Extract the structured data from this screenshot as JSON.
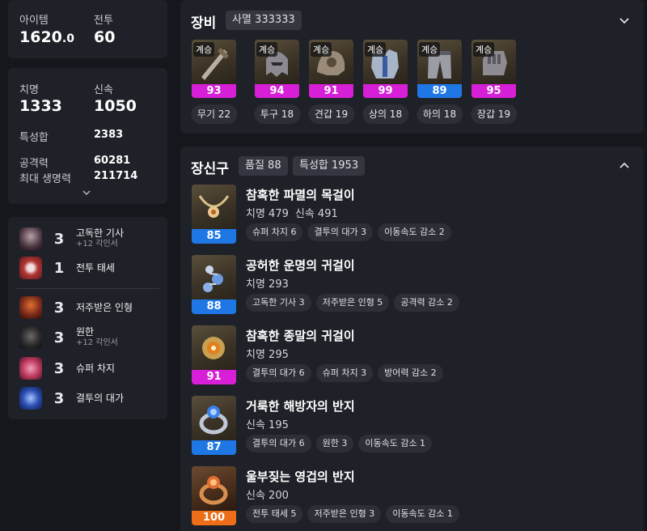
{
  "summary": {
    "item_level_label": "아이템",
    "item_level_main": "1620",
    "item_level_decimal": ".0",
    "combat_label": "전투",
    "combat_value": "60"
  },
  "stats": {
    "crit_label": "치명",
    "crit_value": "1333",
    "swift_label": "신속",
    "swift_value": "1050",
    "total_label": "특성합",
    "total_value": "2383",
    "attack_label": "공격력",
    "attack_value": "60281",
    "hp_label": "최대 생명력",
    "hp_value": "211714"
  },
  "engravings": {
    "class": [
      {
        "level": "3",
        "name": "고독한 기사",
        "sub": "+12 각인서",
        "color": "#4a3540"
      },
      {
        "level": "1",
        "name": "전투 태세",
        "sub": "",
        "color": "#b33535"
      }
    ],
    "items": [
      {
        "level": "3",
        "name": "저주받은 인형",
        "sub": "",
        "color": "#7a2a1a"
      },
      {
        "level": "3",
        "name": "원한",
        "sub": "+12 각인서",
        "color": "#2a2a2a"
      },
      {
        "level": "3",
        "name": "슈퍼 차지",
        "sub": "",
        "color": "#c23e62"
      },
      {
        "level": "3",
        "name": "결투의 대가",
        "sub": "",
        "color": "#2c4fb3"
      }
    ]
  },
  "equipment": {
    "title": "장비",
    "tag": "사멸 333333",
    "items": [
      {
        "badge": "계승",
        "quality": "93",
        "label": "무기 22",
        "quality_color": "#d61fd6"
      },
      {
        "badge": "계승",
        "quality": "94",
        "label": "투구 18",
        "quality_color": "#d61fd6"
      },
      {
        "badge": "계승",
        "quality": "91",
        "label": "견갑 19",
        "quality_color": "#d61fd6"
      },
      {
        "badge": "계승",
        "quality": "99",
        "label": "상의 18",
        "quality_color": "#d61fd6"
      },
      {
        "badge": "계승",
        "quality": "89",
        "label": "하의 18",
        "quality_color": "#1f77e6"
      },
      {
        "badge": "계승",
        "quality": "95",
        "label": "장갑 19",
        "quality_color": "#d61fd6"
      }
    ]
  },
  "accessories": {
    "title": "장신구",
    "quality_tag": "품질 88",
    "stat_tag": "특성합 1953",
    "items": [
      {
        "quality": "85",
        "name": "참혹한 파멸의 목걸이",
        "stats": [
          "치명 479",
          "신속 491"
        ],
        "engravings": [
          "슈퍼 차지 6",
          "결투의 대가 3",
          "이동속도 감소 2"
        ],
        "quality_color": "#1f77e6"
      },
      {
        "quality": "88",
        "name": "공허한 운명의 귀걸이",
        "stats": [
          "치명 293"
        ],
        "engravings": [
          "고독한 기사 3",
          "저주받은 인형 5",
          "공격력 감소 2"
        ],
        "quality_color": "#1f77e6"
      },
      {
        "quality": "91",
        "name": "참혹한 종말의 귀걸이",
        "stats": [
          "치명 295"
        ],
        "engravings": [
          "결투의 대가 6",
          "슈퍼 차지 3",
          "방어력 감소 2"
        ],
        "quality_color": "#d61fd6"
      },
      {
        "quality": "87",
        "name": "거룩한 해방자의 반지",
        "stats": [
          "신속 195"
        ],
        "engravings": [
          "결투의 대가 6",
          "원한 3",
          "이동속도 감소 1"
        ],
        "quality_color": "#1f77e6"
      },
      {
        "quality": "100",
        "name": "울부짖는 영겁의 반지",
        "stats": [
          "신속 200"
        ],
        "engravings": [
          "전투 태세 5",
          "저주받은 인형 3",
          "이동속도 감소 1"
        ],
        "quality_color": "#ee6d18"
      }
    ]
  }
}
